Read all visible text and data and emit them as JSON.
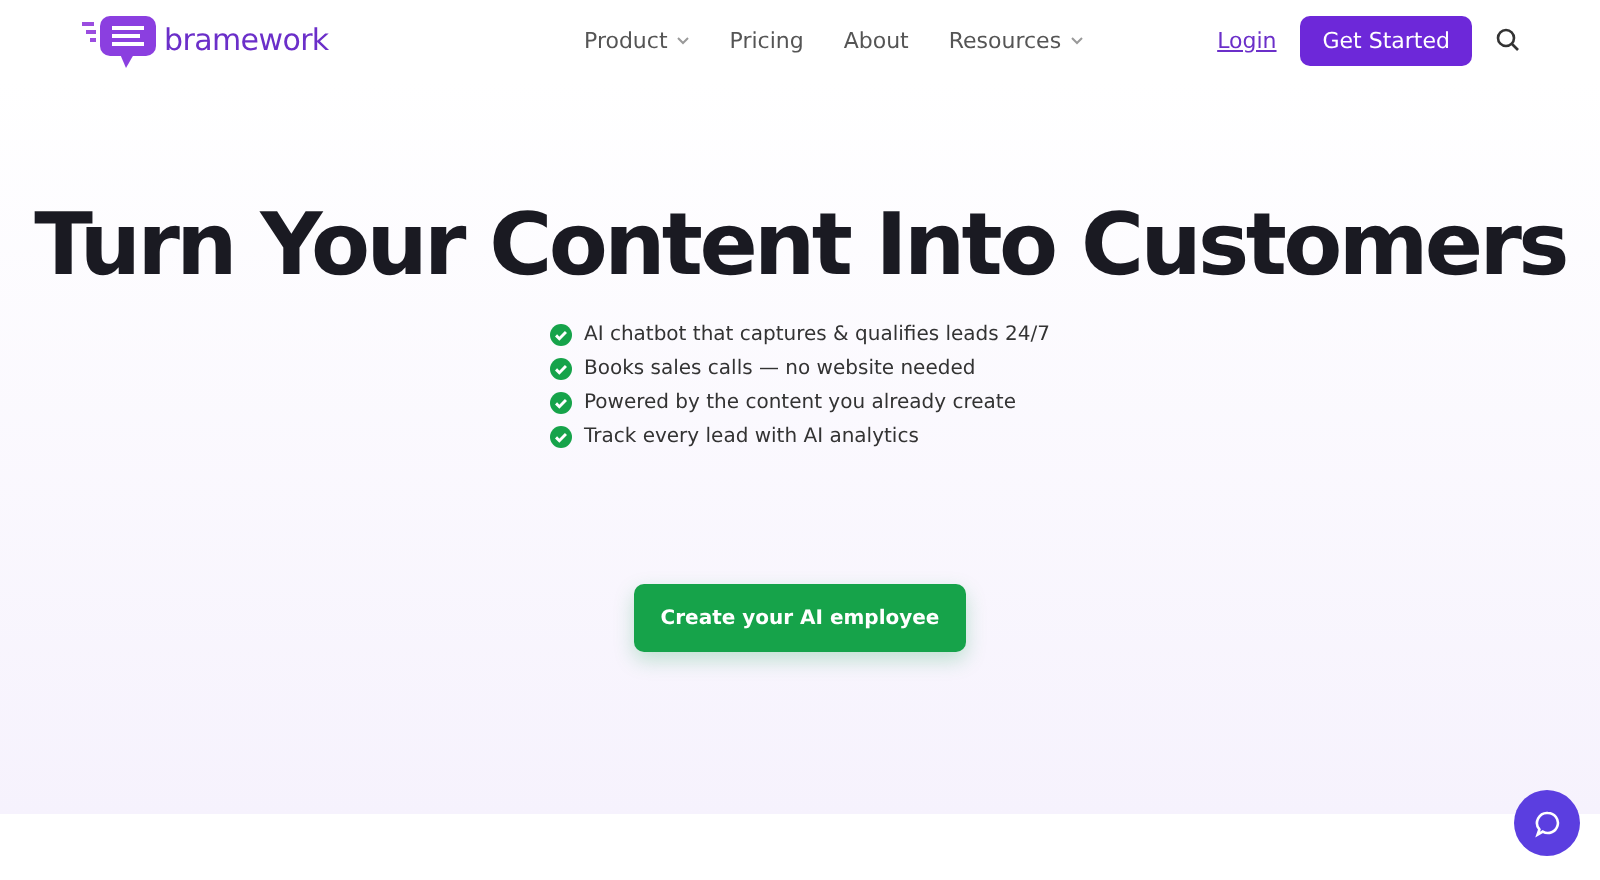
{
  "header": {
    "logo": "bramework",
    "nav": [
      {
        "label": "Product",
        "has_menu": true
      },
      {
        "label": "Pricing",
        "has_menu": false
      },
      {
        "label": "About",
        "has_menu": false
      },
      {
        "label": "Resources",
        "has_menu": true
      }
    ],
    "login": "Login",
    "cta": "Get Started"
  },
  "hero": {
    "title": "Turn Your Content Into Customers",
    "features": [
      "AI chatbot that captures & qualifies leads 24/7",
      "Books sales calls — no website needed",
      "Powered by the content you already create",
      "Track every lead with AI analytics"
    ],
    "button": "Create your AI employee"
  }
}
